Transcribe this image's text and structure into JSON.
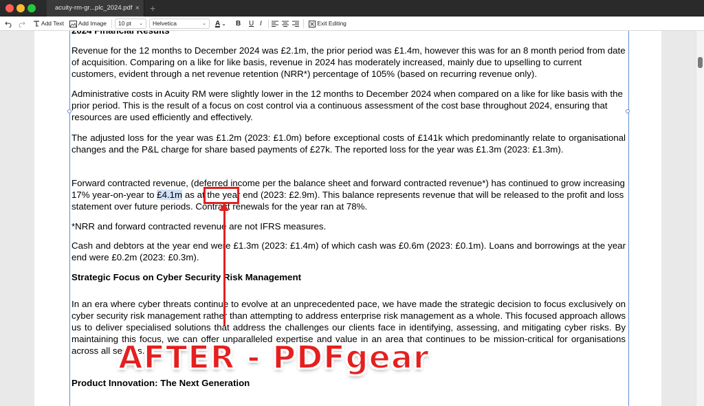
{
  "window": {
    "tab_title": "acuity-rm-gr...plc_2024.pdf",
    "tab_close": "×",
    "new_tab": "+"
  },
  "toolbar": {
    "undo_icon": "undo-icon",
    "redo_icon": "redo-icon",
    "add_text": "Add Text",
    "add_image": "Add Image",
    "font_size": "10  pt",
    "font_family": "Helvetica",
    "font_color_glyph": "A",
    "bold": "B",
    "italic": "I",
    "exit_editing": "Exit Editing",
    "accent_color": "#5b8ed6"
  },
  "document": {
    "heading_top": "2024 Financial Results",
    "para1": "Revenue for the 12 months to December 2024 was £2.1m, the prior period was £1.4m, however this was for an 8 month period from date of acquisition. Comparing on a like for like basis, revenue in 2024 has moderately increased, mainly due to upselling to current customers, evident through a net revenue retention (NRR*) percentage of 105% (based on recurring revenue only).",
    "para2": "Administrative costs in Acuity RM were slightly lower in the 12 months to December 2024 when compared on a like for like basis with the prior period. This is the result of a focus on cost control via a continuous assessment of the cost base throughout 2024, ensuring that resources are used efficiently and effectively.",
    "para3": "The adjusted loss for the year was £1.2m (2023: £1.0m) before exceptional costs of £141k which predominantly relate to organisational changes and the P&L charge for share based payments of £27k. The reported loss for the year was £1.3m (2023: £1.3m).",
    "para4_a": "Forward contracted revenue, (deferred income per the balance sheet and forward contracted revenue*) has continued to grow increasing 17% year-on-year to ",
    "para4_highlight": "£4.1m",
    "para4_b": " as at the year end (2023: £2.9m). This balance represents revenue that will be released  to the profit and loss statement over future periods. Contract renewals for the year ran at 78%.",
    "para5": "*NRR and forward contracted revenue are not IFRS measures.",
    "para6": "Cash and debtors at the year end were £1.3m (2023: £1.4m) of which cash was £0.6m (2023: £0.1m). Loans and borrowings at the year end were £0.2m (2023: £0.3m).",
    "heading2": "Strategic Focus on Cyber Security Risk Management",
    "para7": "In an era where cyber threats continue to evolve at an unprecedented pace, we have made the strategic decision to focus exclusively on cyber security risk management rather than attempting to address enterprise risk management as a whole. This focused approach allows us to deliver specialised solutions that address the challenges our clients face in identifying, assessing, and mitigating cyber risks. By maintaining this focus, we can offer unparalleled expertise and value in an area that continues to be mission-critical for organisations across all sectors.",
    "heading3": "Product Innovation: The Next Generation"
  },
  "overlay": {
    "watermark": "AFTER - PDFgear",
    "annotation_color": "#e0201f"
  }
}
